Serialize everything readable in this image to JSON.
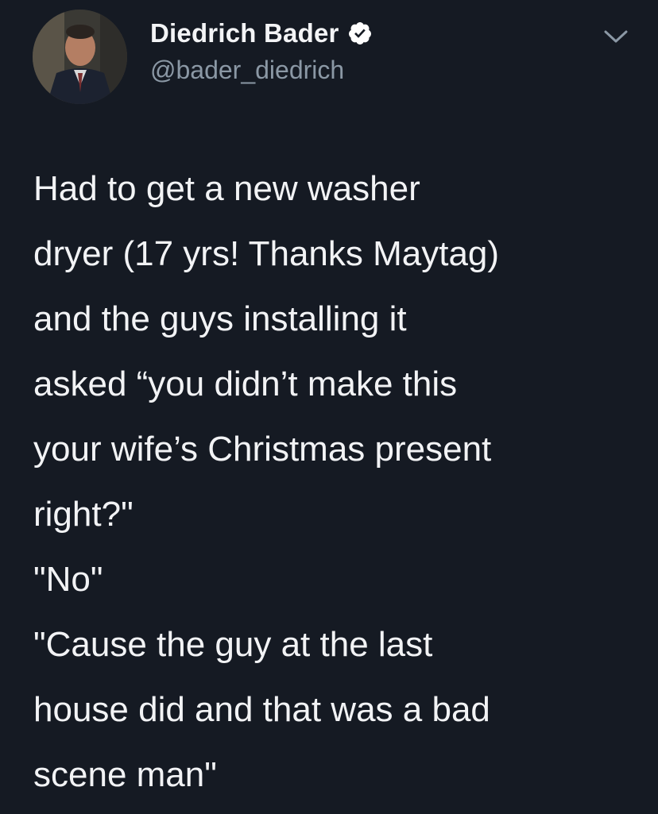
{
  "author": {
    "display_name": "Diedrich Bader",
    "handle": "@bader_diedrich",
    "verified": true,
    "avatar_icon": "profile-photo"
  },
  "tweet": {
    "lines": [
      "Had to get a new washer",
      "dryer (17 yrs! Thanks Maytag)",
      "and the guys installing it",
      "asked “you didn’t make this",
      "your wife’s Christmas present",
      "right?\"",
      "\"No\"",
      "\"Cause the guy at the last",
      "house did and that was a bad",
      "scene man\""
    ]
  },
  "icons": {
    "verified": "verified-badge-icon",
    "menu": "chevron-down-icon"
  },
  "colors": {
    "background": "#151a23",
    "text": "#f2f3f5",
    "secondary_text": "#8b98a5"
  }
}
